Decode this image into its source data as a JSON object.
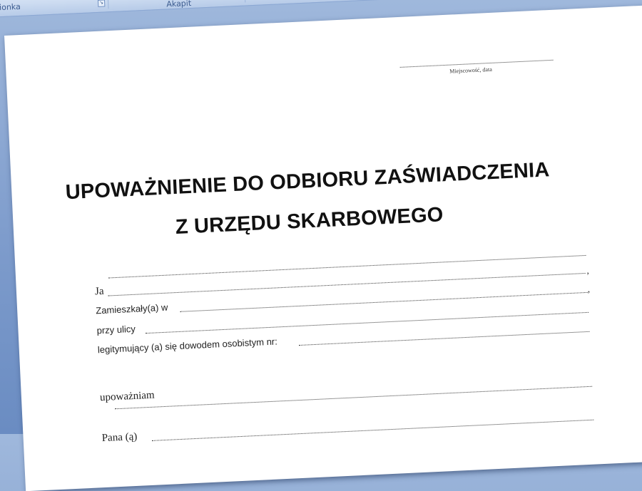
{
  "ribbon": {
    "font_group_label": "zcionka",
    "paragraph_group_label": "Akapit",
    "launcher_icon": "dialog-launcher-icon"
  },
  "document": {
    "place_date_caption": "Miejscowość, data",
    "title_line1": "UPOWAŻNIENIE DO ODBIORU ZAŚWIADCZENIA",
    "title_line2": "Z URZĘDU SKARBOWEGO",
    "field_ja": "Ja",
    "field_address": "Zamieszkały(a) w",
    "field_street": "przy ulicy",
    "field_id": "legitymujący (a) się dowodem osobistym nr:",
    "authorize_text": "upoważniam",
    "field_pan": "Pana (ą)"
  }
}
